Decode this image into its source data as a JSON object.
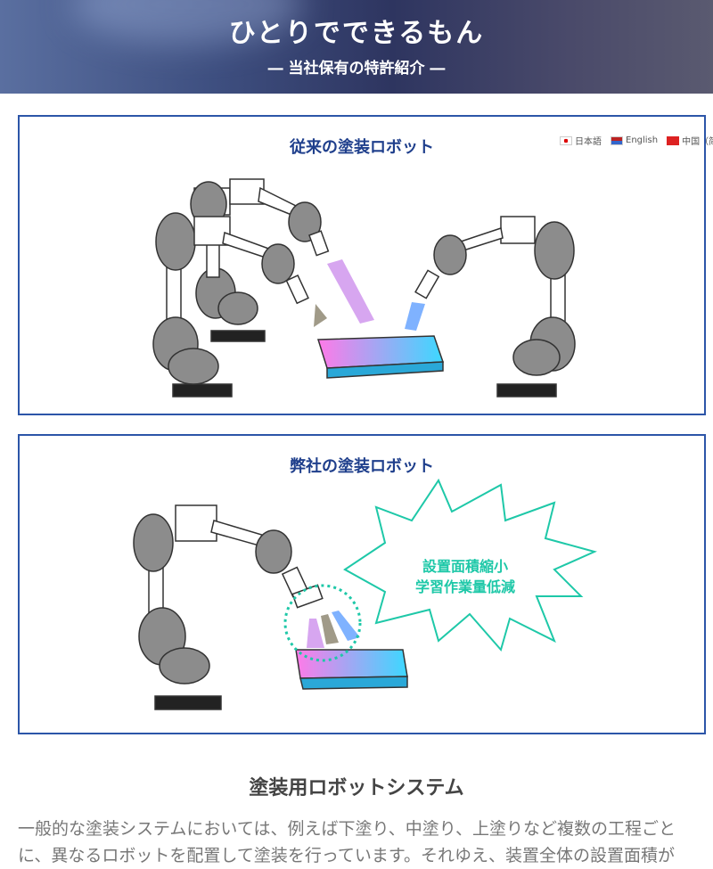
{
  "header": {
    "title": "ひとりでできるもん",
    "subtitle": "― 当社保有の特許紹介 ―"
  },
  "languages": [
    {
      "label": "日本語",
      "flag": "japan-flag-icon"
    },
    {
      "label": "English",
      "flag": "us-flag-icon"
    },
    {
      "label": "中国（简体",
      "flag": "china-flag-icon"
    }
  ],
  "conventional": {
    "title": "従来の塗装ロボット"
  },
  "ours": {
    "title": "弊社の塗装ロボット",
    "callout_line1": "設置面積縮小",
    "callout_line2": "学習作業量低減"
  },
  "section": {
    "title": "塗装用ロボットシステム",
    "paragraph_line1": "一般的な塗装システムにおいては、例えば下塗り、中塗り、上塗りなど複数の工程ごと",
    "paragraph_line2": "に、異なるロボットを配置して塗装を行っています。それゆえ、装置全体の設置面積が"
  },
  "colors": {
    "accent": "#2c55a8",
    "title": "#1f3f8c",
    "callout": "#1ec8a8",
    "robot": "#8c8c8c"
  }
}
